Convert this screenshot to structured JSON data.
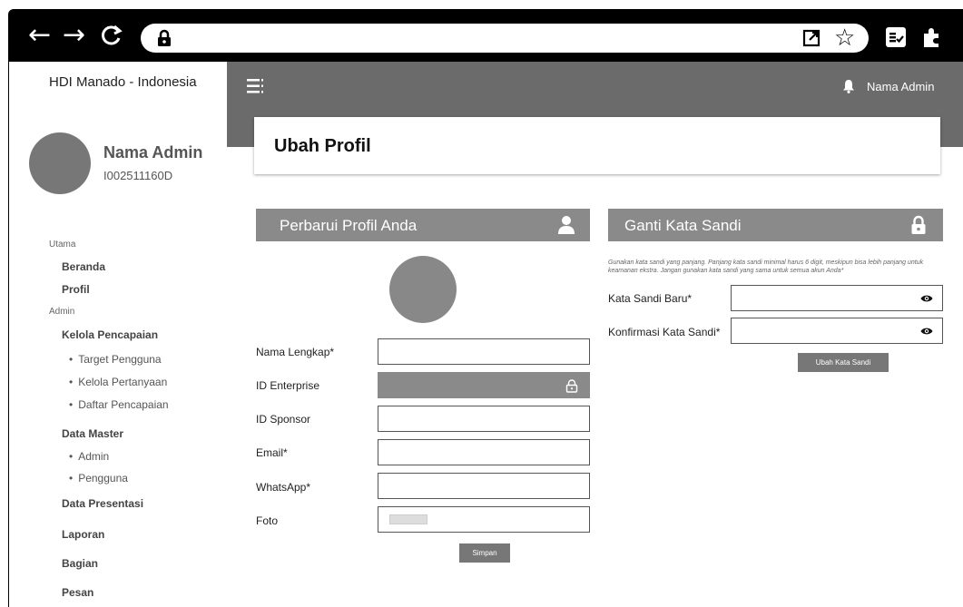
{
  "browser": {
    "icons": [
      "back-arrow-icon",
      "forward-arrow-icon",
      "reload-icon",
      "lock-icon",
      "open-external-icon",
      "star-icon",
      "reading-list-icon",
      "extensions-icon"
    ]
  },
  "sidebar": {
    "brand": "HDI Manado - Indonesia",
    "admin_name": "Nama Admin",
    "admin_id": "I002511160D",
    "section_main": "Utama",
    "home": "Beranda",
    "profile": "Profil",
    "section_admin": "Admin",
    "achievements": "Kelola Pencapaian",
    "achievement_items": [
      "Target Pengguna",
      "Kelola Pertanyaan",
      "Daftar Pencapaian"
    ],
    "master_data": "Data Master",
    "master_items": [
      "Admin",
      "Pengguna"
    ],
    "presentation": "Data Presentasi",
    "report": "Laporan",
    "division": "Bagian",
    "message": "Pesan"
  },
  "topbar": {
    "user": "Nama Admin"
  },
  "page": {
    "title": "Ubah Profil"
  },
  "profile_form": {
    "header": "Perbarui Profil Anda",
    "full_name_label": "Nama Lengkap*",
    "full_name_value": "",
    "enterprise_label": "ID Enterprise",
    "sponsor_label": "ID Sponsor",
    "sponsor_value": "",
    "email_label": "Email*",
    "email_value": "",
    "whatsapp_label": "WhatsApp*",
    "whatsapp_value": "",
    "photo_label": "Foto",
    "save_label": "Simpan"
  },
  "password_form": {
    "header": "Ganti Kata Sandi",
    "note": "Gunakan kata sandi yang panjang. Panjang kata sandi minimal harus 6 digit, meskipun bisa lebih panjang untuk keamanan ekstra. Jangan gunakan kata sandi yang sama untuk semua akun Anda*",
    "new_label": "Kata Sandi Baru*",
    "confirm_label": "Konfirmasi Kata Sandi*",
    "submit_label": "Ubah Kata Sandi"
  },
  "colors": {
    "topbar": "#6b6b6b",
    "panel_header": "#8a8a8a",
    "button": "#777777"
  }
}
